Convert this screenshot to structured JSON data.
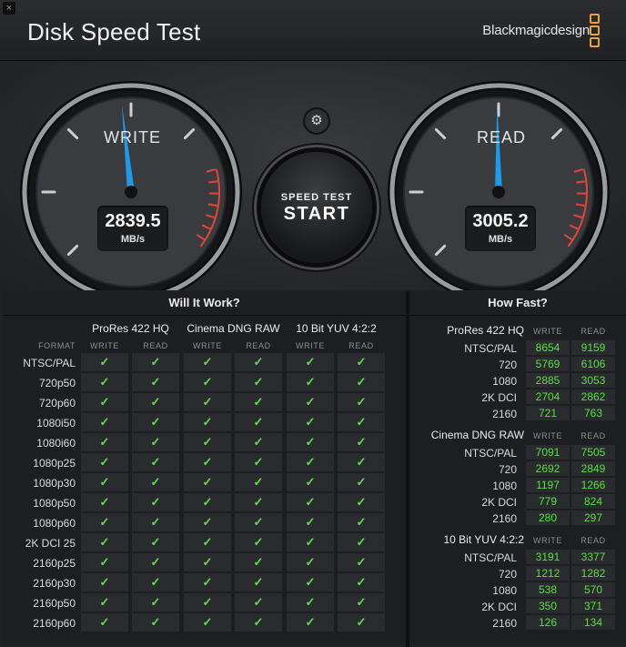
{
  "window": {
    "close_glyph": "×",
    "title": "Disk Speed Test",
    "brand": "Blackmagicdesign"
  },
  "gear": {
    "glyph": "⚙"
  },
  "gauges": {
    "write": {
      "label": "WRITE",
      "value": "2839.5",
      "unit": "MB/s"
    },
    "read": {
      "label": "READ",
      "value": "3005.2",
      "unit": "MB/s"
    }
  },
  "start": {
    "line1": "SPEED TEST",
    "line2": "START"
  },
  "will_it_work": {
    "title": "Will It Work?",
    "format_label": "FORMAT",
    "write_label": "WRITE",
    "read_label": "READ",
    "groups": [
      "ProRes 422 HQ",
      "Cinema DNG RAW",
      "10 Bit YUV 4:2:2"
    ],
    "formats": [
      "NTSC/PAL",
      "720p50",
      "720p60",
      "1080i50",
      "1080i60",
      "1080p25",
      "1080p30",
      "1080p50",
      "1080p60",
      "2K DCI 25",
      "2160p25",
      "2160p30",
      "2160p50",
      "2160p60"
    ],
    "check_glyph": "✓"
  },
  "how_fast": {
    "title": "How Fast?",
    "write_label": "WRITE",
    "read_label": "READ",
    "groups": [
      {
        "name": "ProRes 422 HQ",
        "rows": [
          {
            "label": "NTSC/PAL",
            "write": "8654",
            "read": "9159"
          },
          {
            "label": "720",
            "write": "5769",
            "read": "6106"
          },
          {
            "label": "1080",
            "write": "2885",
            "read": "3053"
          },
          {
            "label": "2K DCI",
            "write": "2704",
            "read": "2862"
          },
          {
            "label": "2160",
            "write": "721",
            "read": "763"
          }
        ]
      },
      {
        "name": "Cinema DNG RAW",
        "rows": [
          {
            "label": "NTSC/PAL",
            "write": "7091",
            "read": "7505"
          },
          {
            "label": "720",
            "write": "2692",
            "read": "2849"
          },
          {
            "label": "1080",
            "write": "1197",
            "read": "1266"
          },
          {
            "label": "2K DCI",
            "write": "779",
            "read": "824"
          },
          {
            "label": "2160",
            "write": "280",
            "read": "297"
          }
        ]
      },
      {
        "name": "10 Bit YUV 4:2:2",
        "rows": [
          {
            "label": "NTSC/PAL",
            "write": "3191",
            "read": "3377"
          },
          {
            "label": "720",
            "write": "1212",
            "read": "1282"
          },
          {
            "label": "1080",
            "write": "538",
            "read": "570"
          },
          {
            "label": "2K DCI",
            "write": "350",
            "read": "371"
          },
          {
            "label": "2160",
            "write": "126",
            "read": "134"
          }
        ]
      }
    ]
  },
  "colors": {
    "needle": "#1e9be8",
    "check": "#5ee04a",
    "value_green": "#59e03f",
    "redzone": "#e0463a",
    "logo": "#e8a43a"
  }
}
